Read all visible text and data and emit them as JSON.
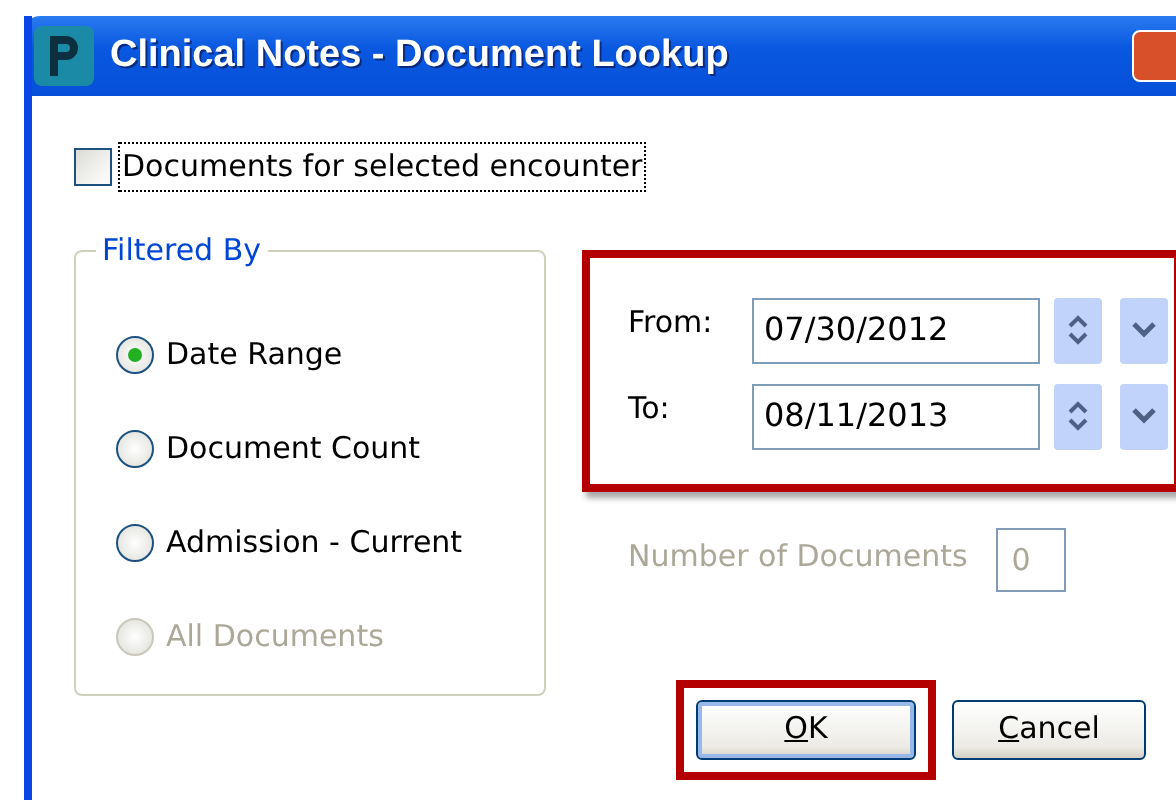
{
  "window": {
    "title": "Clinical Notes - Document Lookup"
  },
  "encounter_checkbox": {
    "label": "Documents for selected encounter",
    "checked": false,
    "focused": true
  },
  "filtered_by": {
    "title": "Filtered By",
    "options": [
      {
        "label": "Date Range",
        "selected": true,
        "disabled": false
      },
      {
        "label": "Document Count",
        "selected": false,
        "disabled": false
      },
      {
        "label": "Admission - Current",
        "selected": false,
        "disabled": false
      },
      {
        "label": "All Documents",
        "selected": false,
        "disabled": true
      }
    ]
  },
  "date_range": {
    "highlighted": true,
    "fields": [
      {
        "label": "From:",
        "value": "07/30/2012"
      },
      {
        "label": "To:",
        "value": "08/11/2013"
      }
    ]
  },
  "document_count": {
    "label": "Number of Documents",
    "value": "0",
    "disabled": true
  },
  "buttons": [
    {
      "label": "OK",
      "access_key_underlined": true,
      "highlighted": true,
      "default": true
    },
    {
      "label": "Cancel",
      "access_key_underlined": true,
      "highlighted": false,
      "default": false
    }
  ]
}
